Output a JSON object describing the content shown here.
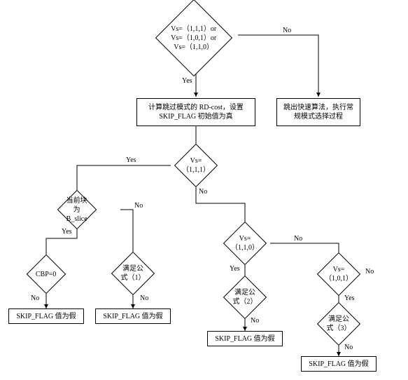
{
  "decision_top": "Vs=（1,1,1）or\nVs=（1,0,1）or\nVs=（1,1,0）",
  "process_calc": "计算跳过模式的 RD-cost，设置\nSKIP_FLAG 初始值为真",
  "process_exit": "跳出快速算法，执行常\n规模式选择过程",
  "decision_vs111": "Vs=（1,1,1）",
  "decision_bslice": "当前块为 B_slice",
  "decision_cbp": "CBP=0",
  "decision_formula1": "满足公式（1）",
  "decision_vs110": "Vs=（1,1,0）",
  "decision_formula2": "满足公式（2）",
  "decision_vs101": "Vs=（1,0,1）",
  "decision_formula3": "满足公式（3）",
  "result_false": "SKIP_FLAG 值为假",
  "labels": {
    "yes": "Yes",
    "no": "No"
  },
  "chart_data": {
    "type": "flowchart",
    "title": "",
    "nodes": [
      {
        "id": "d_top",
        "shape": "diamond",
        "text": "Vs=(1,1,1) or Vs=(1,0,1) or Vs=(1,1,0)"
      },
      {
        "id": "p_calc",
        "shape": "rect",
        "text": "计算跳过模式的 RD-cost，设置 SKIP_FLAG 初始值为真"
      },
      {
        "id": "p_exit",
        "shape": "rect",
        "text": "跳出快速算法，执行常规模式选择过程"
      },
      {
        "id": "d_vs111",
        "shape": "diamond",
        "text": "Vs=(1,1,1)"
      },
      {
        "id": "d_bslice",
        "shape": "diamond",
        "text": "当前块为 B_slice"
      },
      {
        "id": "d_cbp",
        "shape": "diamond",
        "text": "CBP=0"
      },
      {
        "id": "d_f1",
        "shape": "diamond",
        "text": "满足公式(1)"
      },
      {
        "id": "d_vs110",
        "shape": "diamond",
        "text": "Vs=(1,1,0)"
      },
      {
        "id": "d_f2",
        "shape": "diamond",
        "text": "满足公式(2)"
      },
      {
        "id": "d_vs101",
        "shape": "diamond",
        "text": "Vs=(1,0,1)"
      },
      {
        "id": "d_f3",
        "shape": "diamond",
        "text": "满足公式(3)"
      },
      {
        "id": "r1",
        "shape": "rect",
        "text": "SKIP_FLAG 值为假"
      },
      {
        "id": "r2",
        "shape": "rect",
        "text": "SKIP_FLAG 值为假"
      },
      {
        "id": "r3",
        "shape": "rect",
        "text": "SKIP_FLAG 值为假"
      },
      {
        "id": "r4",
        "shape": "rect",
        "text": "SKIP_FLAG 值为假"
      }
    ],
    "edges": [
      {
        "from": "d_top",
        "to": "p_calc",
        "label": "Yes"
      },
      {
        "from": "d_top",
        "to": "p_exit",
        "label": "No"
      },
      {
        "from": "p_calc",
        "to": "d_vs111",
        "label": ""
      },
      {
        "from": "d_vs111",
        "to": "d_bslice",
        "label": "Yes"
      },
      {
        "from": "d_vs111",
        "to": "d_vs110",
        "label": "No"
      },
      {
        "from": "d_bslice",
        "to": "d_cbp",
        "label": "Yes"
      },
      {
        "from": "d_bslice",
        "to": "d_f1",
        "label": "No"
      },
      {
        "from": "d_cbp",
        "to": "r1",
        "label": "No"
      },
      {
        "from": "d_f1",
        "to": "r2",
        "label": "No"
      },
      {
        "from": "d_vs110",
        "to": "d_f2",
        "label": "Yes"
      },
      {
        "from": "d_vs110",
        "to": "d_vs101",
        "label": "No"
      },
      {
        "from": "d_f2",
        "to": "r3",
        "label": "No"
      },
      {
        "from": "d_vs101",
        "to": "d_f3",
        "label": "Yes"
      },
      {
        "from": "d_f3",
        "to": "r4",
        "label": "No"
      }
    ]
  }
}
